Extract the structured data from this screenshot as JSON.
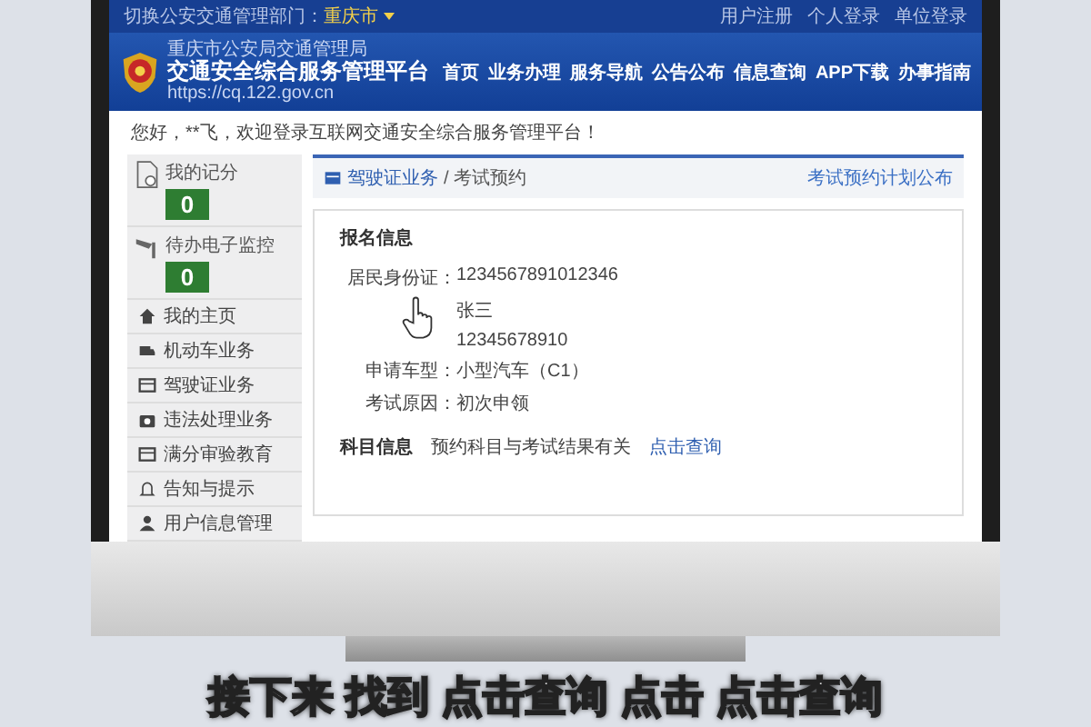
{
  "top_bar": {
    "department_label": "切换公安交通管理部门：",
    "department": "重庆市",
    "links": [
      "用户注册",
      "个人登录",
      "单位登录"
    ]
  },
  "header": {
    "org": "重庆市公安局交通管理局",
    "title": "交通安全综合服务管理平台",
    "url": "https://cq.122.gov.cn",
    "nav": [
      "首页",
      "业务办理",
      "服务导航",
      "公告公布",
      "信息查询",
      "APP下载",
      "办事指南"
    ]
  },
  "welcome": "您好，**飞，欢迎登录互联网交通安全综合服务管理平台！",
  "sidebar": {
    "counters": [
      {
        "label": "我的记分",
        "value": "0"
      },
      {
        "label": "待办电子监控",
        "value": "0"
      }
    ],
    "items": [
      "我的主页",
      "机动车业务",
      "驾驶证业务",
      "违法处理业务",
      "满分审验教育",
      "告知与提示",
      "用户信息管理"
    ]
  },
  "breadcrumb": {
    "section": "驾驶证业务",
    "page": "/ 考试预约",
    "link": "考试预约计划公布"
  },
  "form": {
    "heading": "报名信息",
    "fields": [
      {
        "label": "居民身份证：",
        "value": "1234567891012346"
      },
      {
        "value": "张三"
      },
      {
        "value": "12345678910"
      },
      {
        "label": "申请车型：",
        "value": "小型汽车（C1）"
      },
      {
        "label": "考试原因：",
        "value": "初次申领"
      }
    ],
    "subject": {
      "label": "科目信息",
      "text": "预约科目与考试结果有关",
      "link": "点击查询"
    }
  },
  "subtitle": "接下来 找到 点击查询 点击 点击查询"
}
